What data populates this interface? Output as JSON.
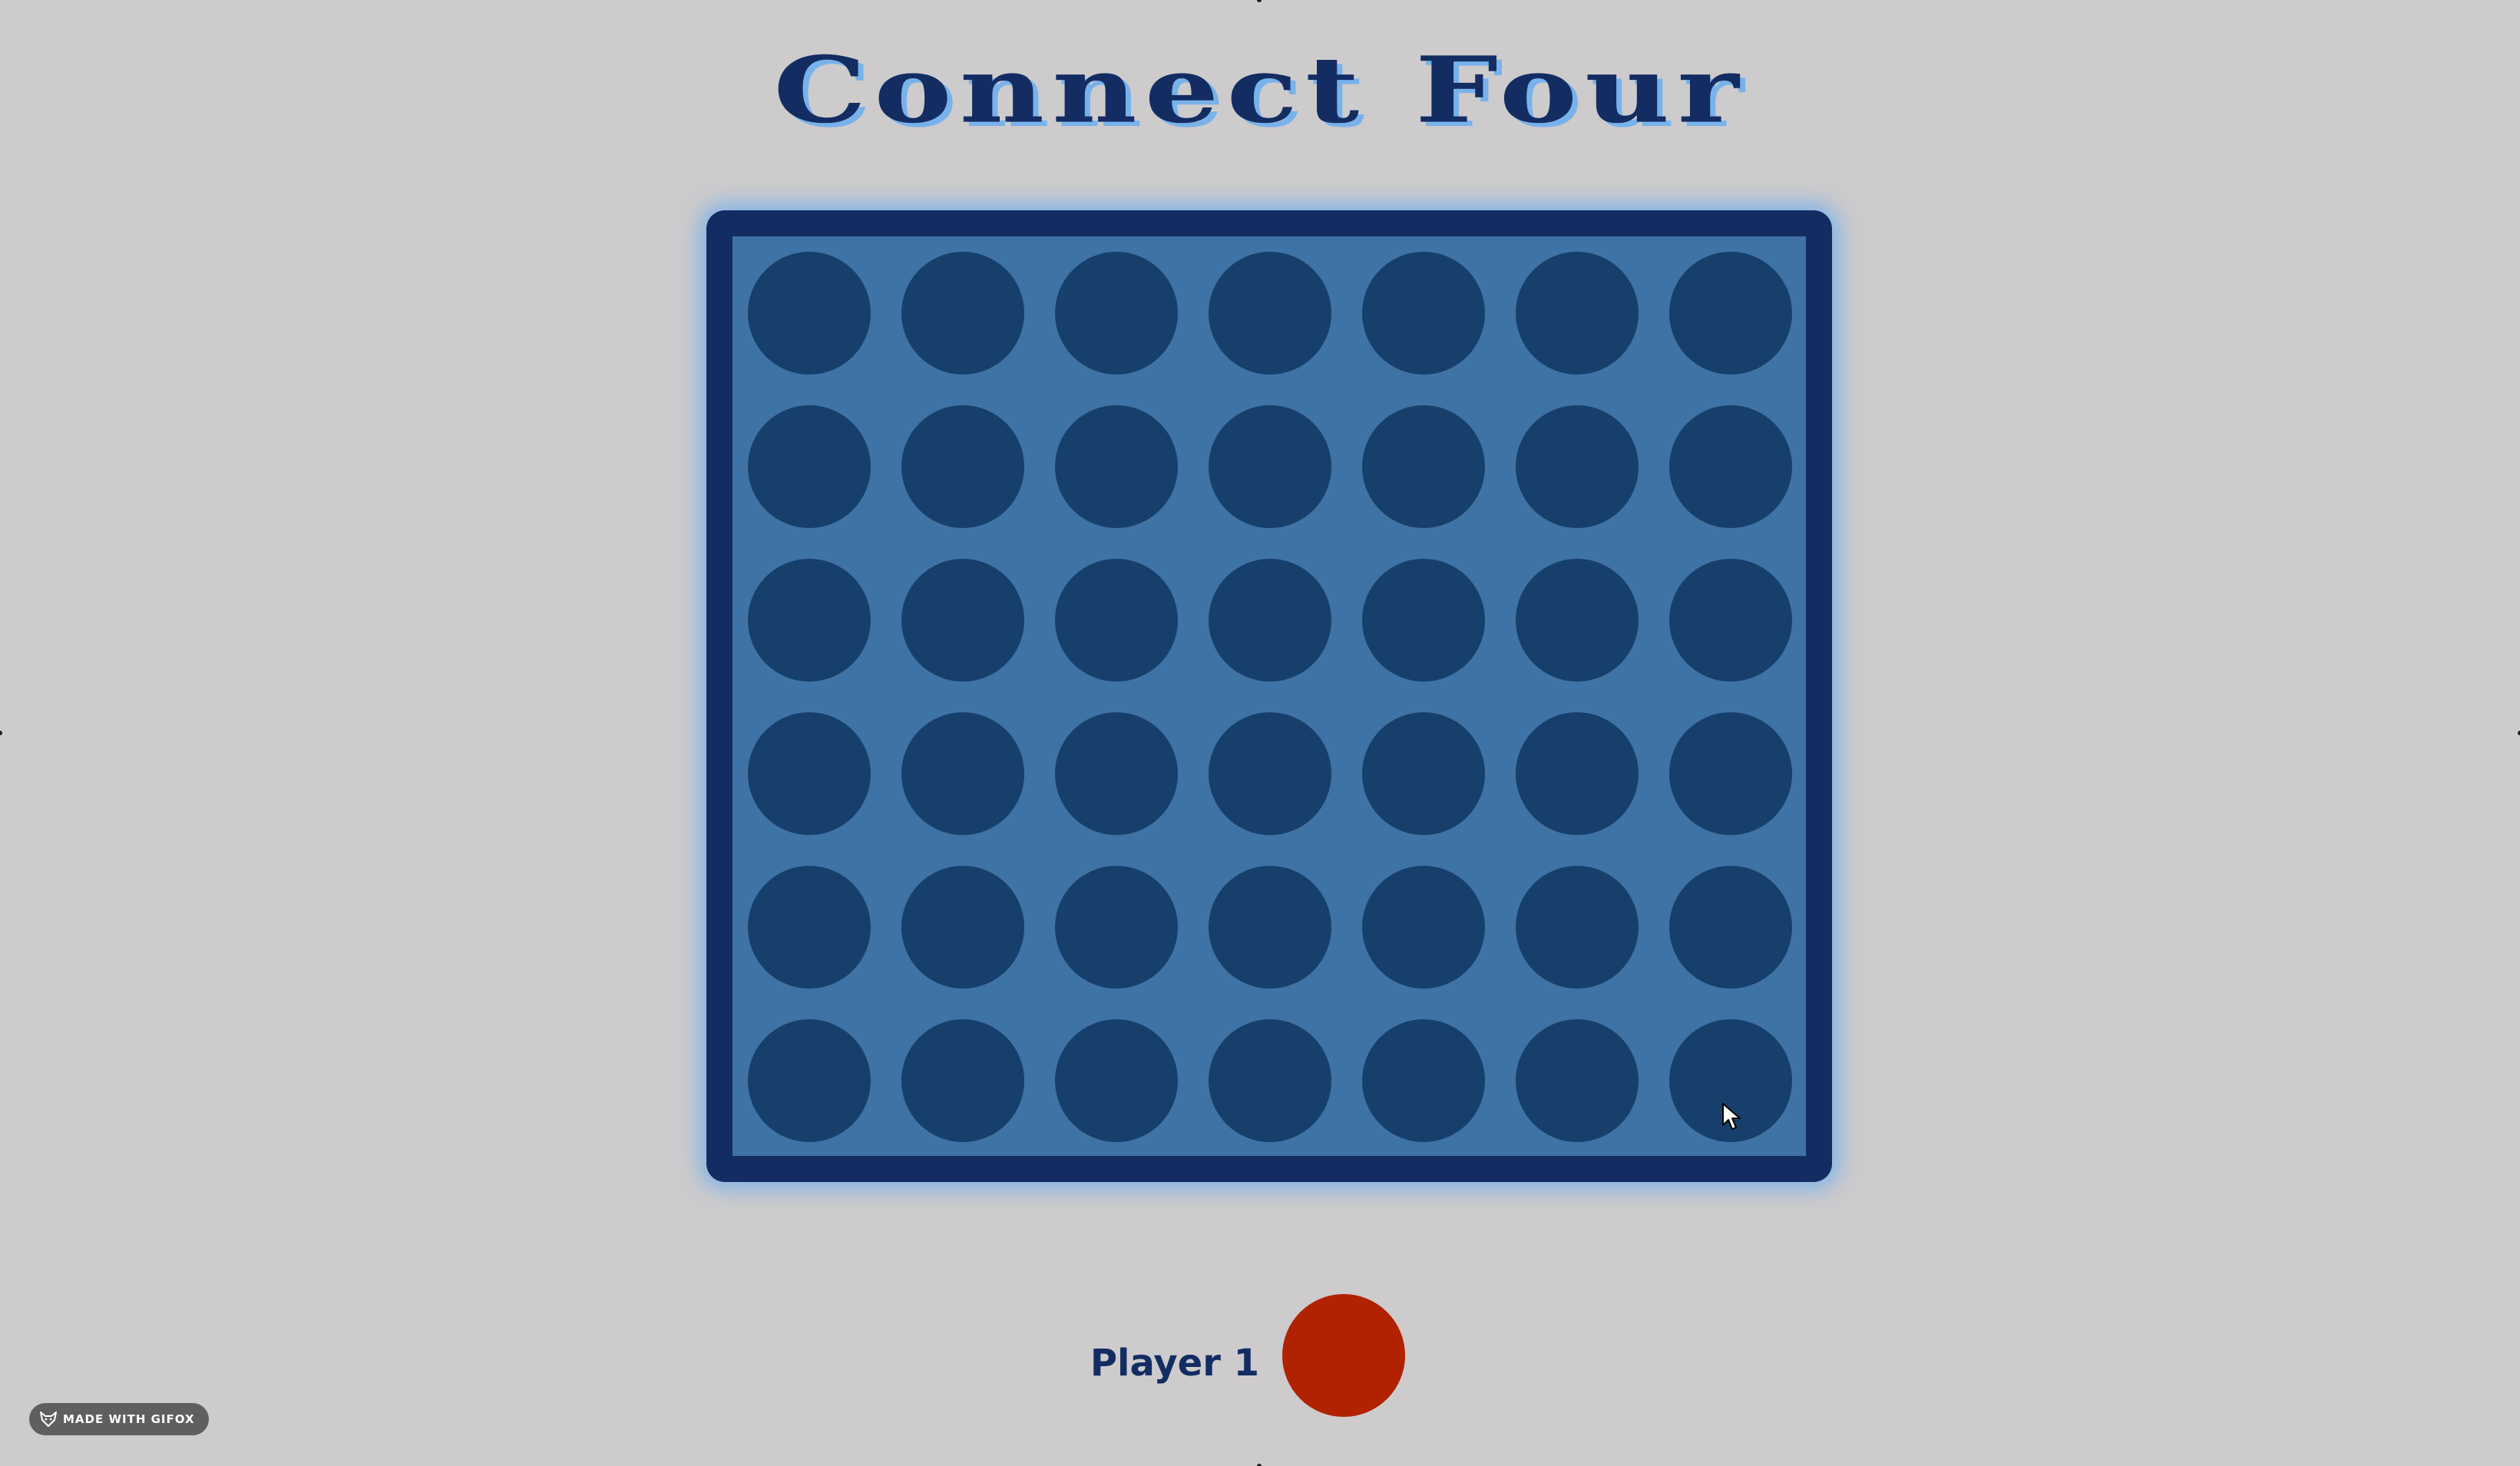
{
  "title": "Connect Four",
  "colors": {
    "background": "#cdcbcc",
    "title_text": "#132d63",
    "title_shadow": "#78b2ea",
    "board_frame": "#132d63",
    "board_fill": "#3f72a5",
    "empty_slot": "#173f6b",
    "player1_disc": "#b02200",
    "turn_label": "#132d63"
  },
  "board": {
    "rows": 6,
    "columns": 7,
    "cells": [
      [
        "empty",
        "empty",
        "empty",
        "empty",
        "empty",
        "empty",
        "empty"
      ],
      [
        "empty",
        "empty",
        "empty",
        "empty",
        "empty",
        "empty",
        "empty"
      ],
      [
        "empty",
        "empty",
        "empty",
        "empty",
        "empty",
        "empty",
        "empty"
      ],
      [
        "empty",
        "empty",
        "empty",
        "empty",
        "empty",
        "empty",
        "empty"
      ],
      [
        "empty",
        "empty",
        "empty",
        "empty",
        "empty",
        "empty",
        "empty"
      ],
      [
        "empty",
        "empty",
        "empty",
        "empty",
        "empty",
        "empty",
        "empty"
      ]
    ]
  },
  "turn": {
    "label": "Player 1",
    "disc_color": "player1_disc"
  },
  "badge": {
    "text": "MADE WITH GIFOX",
    "icon": "fox-icon"
  },
  "cursor": {
    "icon": "mouse-pointer-icon"
  }
}
